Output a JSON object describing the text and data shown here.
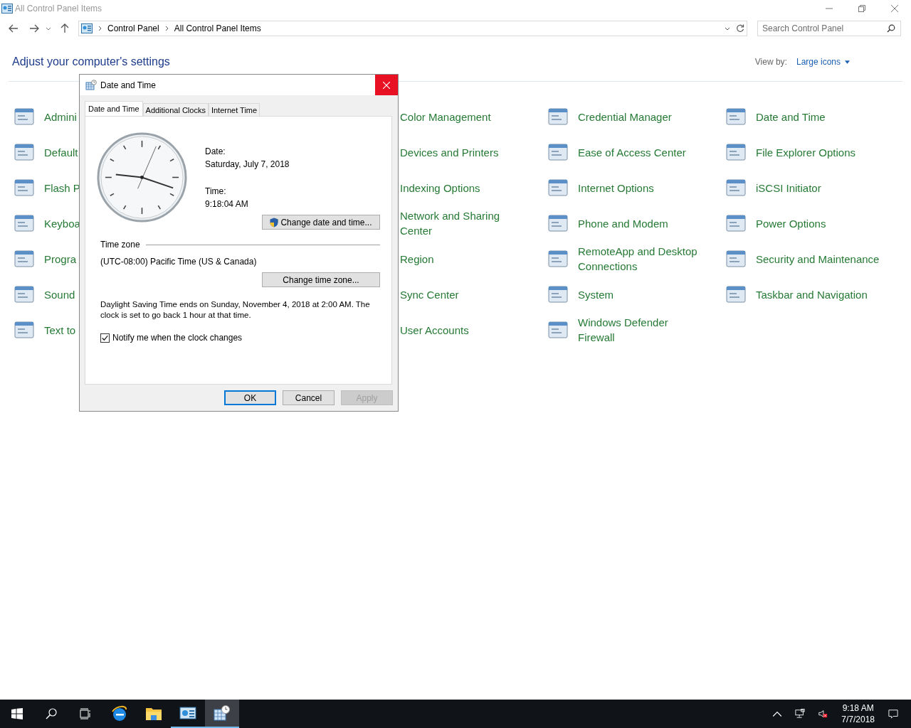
{
  "window": {
    "title": "All Control Panel Items"
  },
  "address": {
    "crumbs": [
      "Control Panel",
      "All Control Panel Items"
    ],
    "search_placeholder": "Search Control Panel"
  },
  "heading": "Adjust your computer's settings",
  "view_by": {
    "label": "View by:",
    "value": "Large icons"
  },
  "columns": [
    {
      "items": [
        "Admini",
        "Default",
        "Flash P",
        "Keyboa",
        "Progra",
        "Sound",
        "Text to"
      ]
    },
    {
      "items": [
        "Color Management",
        "Devices and Printers",
        "Indexing Options",
        "Network and Sharing Center",
        "Region",
        "Sync Center",
        "User Accounts"
      ]
    },
    {
      "items": [
        "Credential Manager",
        "Ease of Access Center",
        "Internet Options",
        "Phone and Modem",
        "RemoteApp and Desktop Connections",
        "System",
        "Windows Defender Firewall"
      ]
    },
    {
      "items": [
        "Date and Time",
        "File Explorer Options",
        "iSCSI Initiator",
        "Power Options",
        "Security and Maintenance",
        "Taskbar and Navigation"
      ]
    }
  ],
  "dialog": {
    "title": "Date and Time",
    "tabs": [
      {
        "label": "Date and Time",
        "selected": true
      },
      {
        "label": "Additional Clocks",
        "selected": false
      },
      {
        "label": "Internet Time",
        "selected": false
      }
    ],
    "date_label": "Date:",
    "date": "Saturday, July 7, 2018",
    "time_label": "Time:",
    "time": "9:18:04 AM",
    "change_datetime_button": "Change date and time...",
    "timezone_label": "Time zone",
    "timezone": "(UTC-08:00) Pacific Time (US & Canada)",
    "change_timezone_button": "Change time zone...",
    "dst_note": "Daylight Saving Time ends on Sunday, November 4, 2018 at 2:00 AM. The clock is set to go back 1 hour at that time.",
    "notify": {
      "label": "Notify me when the clock changes",
      "checked": true
    },
    "buttons": [
      {
        "label": "OK",
        "default": true,
        "disabled": false
      },
      {
        "label": "Cancel",
        "default": false,
        "disabled": false
      },
      {
        "label": "Apply",
        "default": false,
        "disabled": true
      }
    ]
  },
  "taskbar": {
    "apps": [
      {
        "kind": "browser",
        "running": false,
        "selected": false
      },
      {
        "kind": "folder",
        "running": false,
        "selected": false
      },
      {
        "kind": "control-panel",
        "running": true,
        "selected": false
      },
      {
        "kind": "datetime",
        "running": true,
        "selected": true
      }
    ],
    "clock_time": "9:18 AM",
    "clock_date": "7/7/2018"
  }
}
